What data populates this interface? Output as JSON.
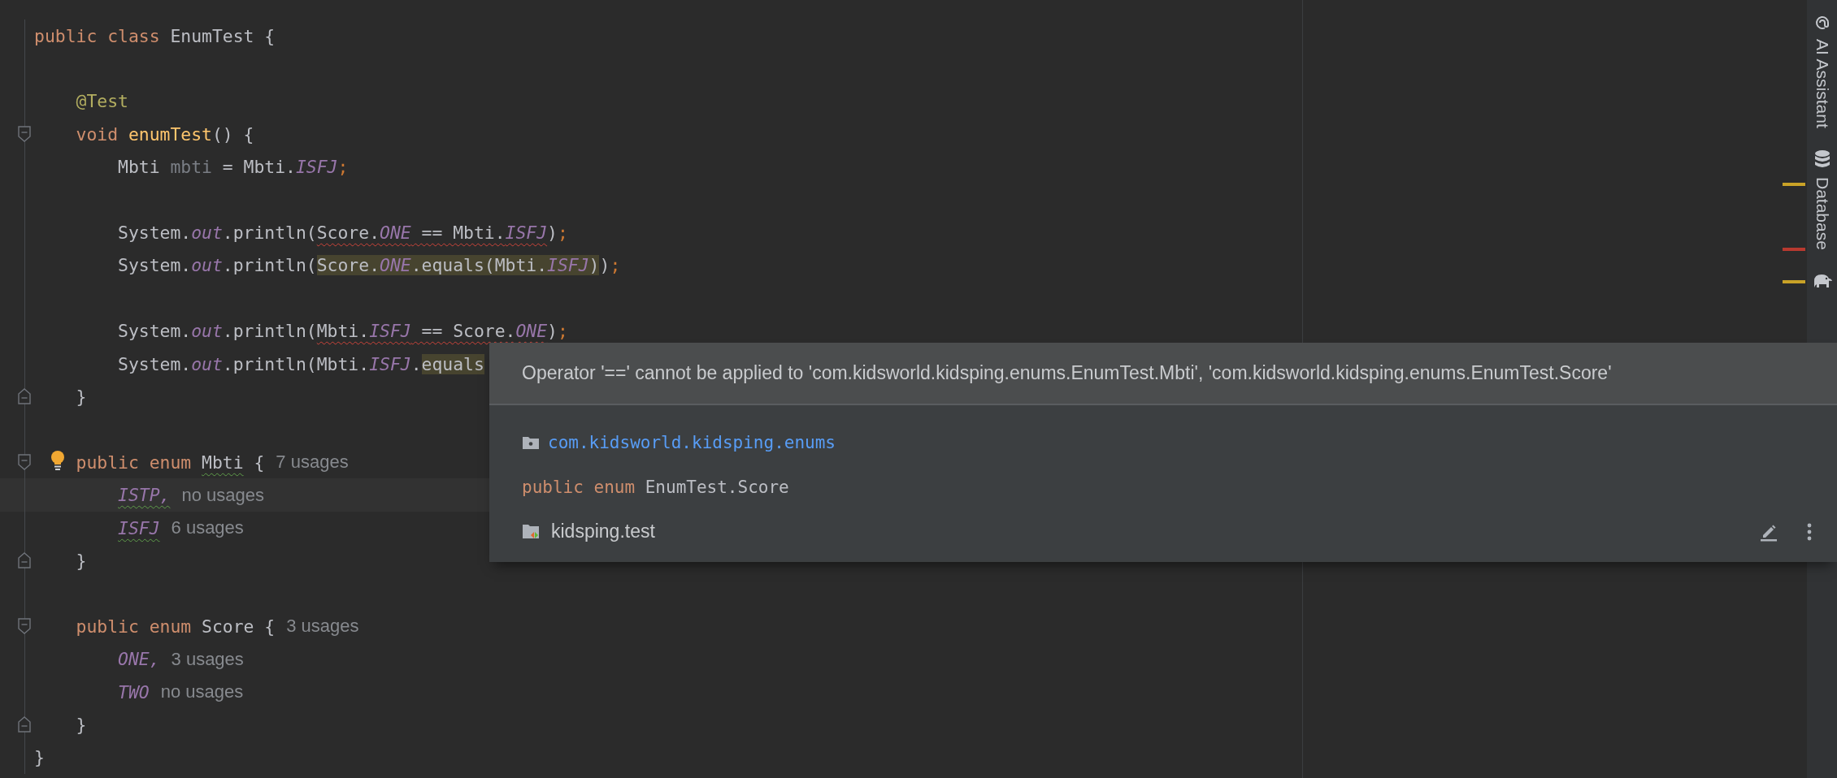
{
  "editor": {
    "lines": [
      {
        "kind": "code",
        "tokens": [
          {
            "text": "public class ",
            "kind": "keyword"
          },
          {
            "text": "EnumTest {",
            "kind": "plain"
          }
        ]
      },
      {
        "kind": "blank"
      },
      {
        "kind": "code",
        "tokens": [
          {
            "text": "    @Test",
            "kind": "annotation"
          }
        ]
      },
      {
        "kind": "fold-start",
        "tokens": [
          {
            "text": "    void ",
            "kind": "keyword"
          },
          {
            "text": "enumTest",
            "kind": "method"
          },
          {
            "text": "() {",
            "kind": "plain"
          }
        ]
      },
      {
        "kind": "code",
        "tokens": [
          {
            "text": "        Mbti ",
            "kind": "plain"
          },
          {
            "text": "mbti",
            "kind": "unused"
          },
          {
            "text": " = Mbti.",
            "kind": "plain"
          },
          {
            "text": "ISFJ",
            "kind": "constant"
          },
          {
            "text": ";",
            "kind": "punct"
          }
        ]
      },
      {
        "kind": "blank"
      },
      {
        "kind": "code",
        "tokens": [
          {
            "text": "        System.",
            "kind": "plain"
          },
          {
            "text": "out",
            "kind": "field"
          },
          {
            "text": ".println(",
            "kind": "plain"
          },
          {
            "text": "Score.",
            "kind": "plain",
            "error": true
          },
          {
            "text": "ONE",
            "kind": "constant",
            "error": true
          },
          {
            "text": " == Mbti.",
            "kind": "plain",
            "error": true
          },
          {
            "text": "ISFJ",
            "kind": "constant",
            "error": true
          },
          {
            "text": ")",
            "kind": "plain"
          },
          {
            "text": ";",
            "kind": "punct"
          }
        ]
      },
      {
        "kind": "code",
        "tokens": [
          {
            "text": "        System.",
            "kind": "plain"
          },
          {
            "text": "out",
            "kind": "field"
          },
          {
            "text": ".println(",
            "kind": "plain"
          },
          {
            "text": "Score.",
            "kind": "plain",
            "matched": true
          },
          {
            "text": "ONE",
            "kind": "constant",
            "matched": true
          },
          {
            "text": ".equals(Mbti.",
            "kind": "plain",
            "matched": true
          },
          {
            "text": "ISFJ",
            "kind": "constant",
            "matched": true
          },
          {
            "text": ")",
            "kind": "plain",
            "matched": true
          },
          {
            "text": ")",
            "kind": "plain"
          },
          {
            "text": ";",
            "kind": "punct"
          }
        ]
      },
      {
        "kind": "blank"
      },
      {
        "kind": "code",
        "tokens": [
          {
            "text": "        System.",
            "kind": "plain"
          },
          {
            "text": "out",
            "kind": "field"
          },
          {
            "text": ".println(",
            "kind": "plain"
          },
          {
            "text": "Mbti.",
            "kind": "plain",
            "error": true
          },
          {
            "text": "ISFJ",
            "kind": "constant",
            "error": true
          },
          {
            "text": " == Score.",
            "kind": "plain",
            "error": true
          },
          {
            "text": "ONE",
            "kind": "constant",
            "error": true
          },
          {
            "text": ")",
            "kind": "plain"
          },
          {
            "text": ";",
            "kind": "punct"
          }
        ]
      },
      {
        "kind": "code",
        "tokens": [
          {
            "text": "        System.",
            "kind": "plain"
          },
          {
            "text": "out",
            "kind": "field"
          },
          {
            "text": ".println(Mbti.",
            "kind": "plain"
          },
          {
            "text": "ISFJ",
            "kind": "constant"
          },
          {
            "text": ".",
            "kind": "plain"
          },
          {
            "text": "equals",
            "kind": "plain",
            "matched": true
          }
        ]
      },
      {
        "kind": "fold-end",
        "tokens": [
          {
            "text": "    }",
            "kind": "plain"
          }
        ]
      },
      {
        "kind": "blank"
      },
      {
        "kind": "fold-start",
        "bulb": true,
        "tokens": [
          {
            "text": "    public enum ",
            "kind": "keyword"
          },
          {
            "text": "Mbti",
            "kind": "plain",
            "warning": true
          },
          {
            "text": " {",
            "kind": "plain"
          }
        ],
        "hint": "7 usages"
      },
      {
        "kind": "code",
        "current": true,
        "tokens": [
          {
            "text": "        ISTP,",
            "kind": "constant",
            "warning": true
          }
        ],
        "hint": "no usages"
      },
      {
        "kind": "code",
        "tokens": [
          {
            "text": "        ISFJ",
            "kind": "constant",
            "warning": true
          }
        ],
        "hint": "6 usages"
      },
      {
        "kind": "fold-end",
        "tokens": [
          {
            "text": "    }",
            "kind": "plain"
          }
        ]
      },
      {
        "kind": "blank"
      },
      {
        "kind": "fold-start",
        "tokens": [
          {
            "text": "    public enum ",
            "kind": "keyword"
          },
          {
            "text": "Score {",
            "kind": "plain"
          }
        ],
        "hint": "3 usages"
      },
      {
        "kind": "code",
        "tokens": [
          {
            "text": "        ONE,",
            "kind": "constant"
          }
        ],
        "hint": "3 usages"
      },
      {
        "kind": "code",
        "tokens": [
          {
            "text": "        TWO",
            "kind": "constant"
          }
        ],
        "hint": "no usages"
      },
      {
        "kind": "fold-end",
        "tokens": [
          {
            "text": "    }",
            "kind": "plain"
          }
        ]
      },
      {
        "kind": "code",
        "tokens": [
          {
            "text": "}",
            "kind": "plain"
          }
        ]
      }
    ],
    "stripe_marks": [
      {
        "color": "#c9a227"
      },
      {
        "color": "#b8392f"
      },
      {
        "color": "#c9a227"
      }
    ]
  },
  "popup": {
    "message": "Operator '==' cannot be applied to 'com.kidsworld.kidsping.enums.EnumTest.Mbti', 'com.kidsworld.kidsping.enums.EnumTest.Score'",
    "package": "com.kidsworld.kidsping.enums",
    "declaration": [
      {
        "text": "public enum ",
        "kind": "keyword"
      },
      {
        "text": "EnumTest.Score",
        "kind": "plain"
      }
    ],
    "module": "kidsping.test"
  },
  "sidebar": {
    "items": [
      {
        "label": "AI Assistant"
      },
      {
        "label": "Database"
      }
    ]
  }
}
